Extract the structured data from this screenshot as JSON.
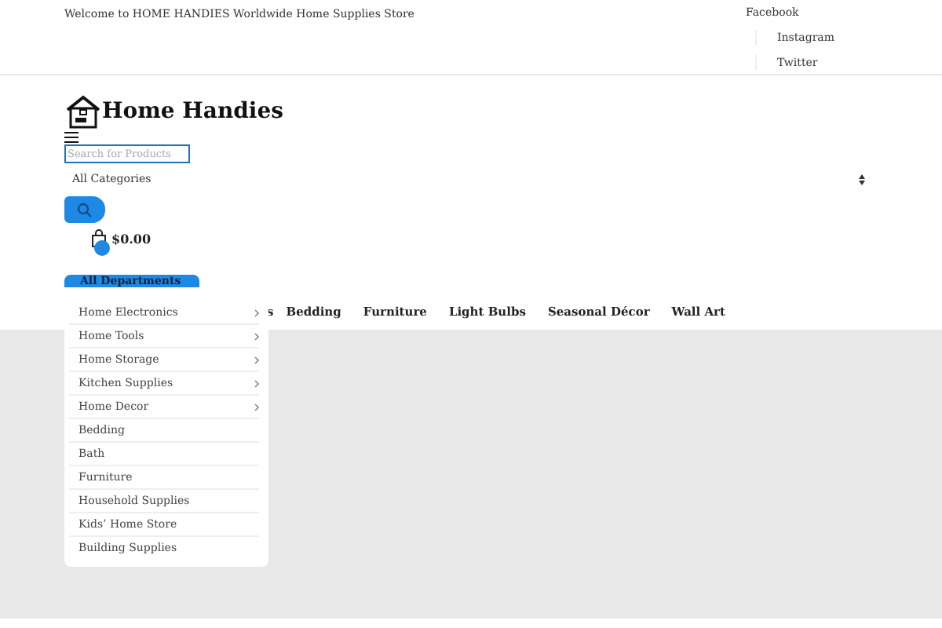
{
  "top_bar": {
    "welcome": "Welcome to HOME HANDIES Worldwide Home Supplies Store",
    "social_links": [
      "Facebook",
      "Instagram",
      "Twitter"
    ]
  },
  "header": {
    "logo_text": "Home Handies",
    "search": {
      "placeholder": "Search for Products"
    },
    "category_select": "All Categories",
    "cart_total": "$0.00"
  },
  "departments_button": "All Departments",
  "nav_items": [
    "s",
    "Bedding",
    "Furniture",
    "Light Bulbs",
    "Seasonal Décor",
    "Wall Art"
  ],
  "departments_menu": [
    {
      "label": "Home Electronics",
      "has_submenu": true
    },
    {
      "label": "Home Tools",
      "has_submenu": true
    },
    {
      "label": "Home Storage",
      "has_submenu": true
    },
    {
      "label": "Kitchen Supplies",
      "has_submenu": true
    },
    {
      "label": "Home Decor",
      "has_submenu": true
    },
    {
      "label": "Bedding",
      "has_submenu": false
    },
    {
      "label": "Bath",
      "has_submenu": false
    },
    {
      "label": "Furniture",
      "has_submenu": false
    },
    {
      "label": "Household Supplies",
      "has_submenu": false
    },
    {
      "label": "Kids’ Home Store",
      "has_submenu": false
    },
    {
      "label": "Building Supplies",
      "has_submenu": false
    }
  ]
}
